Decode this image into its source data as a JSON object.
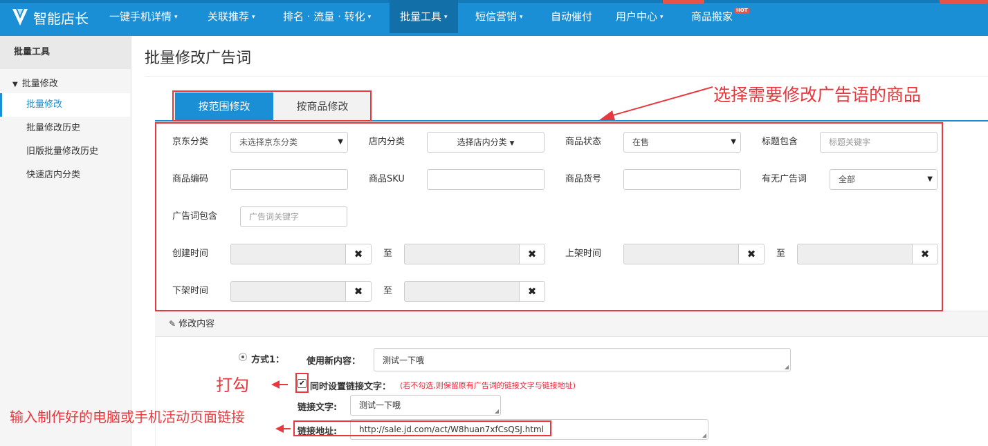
{
  "nav": {
    "brand": "智能店长",
    "items": [
      {
        "label": "一键手机详情",
        "caret": "▾"
      },
      {
        "label": "关联推荐",
        "caret": "▾"
      },
      {
        "label": "排名 · 流量 · 转化",
        "caret": "▾"
      },
      {
        "label": "批量工具",
        "caret": "▾"
      },
      {
        "label": "短信营销",
        "caret": "▾"
      },
      {
        "label": "自动催付",
        "caret": ""
      },
      {
        "label": "用户中心",
        "caret": "▾"
      },
      {
        "label": "商品搬家",
        "caret": ""
      }
    ],
    "hot_badge": "HOT",
    "colors": {
      "bar": "#1a8fd5",
      "active": "#126fa8",
      "accent_red": "#e8534a"
    }
  },
  "sidebar": {
    "header": "批量工具",
    "group": "批量修改",
    "items": [
      "批量修改",
      "批量修改历史",
      "旧版批量修改历史",
      "快速店内分类"
    ]
  },
  "page": {
    "title": "批量修改广告词",
    "tabs": [
      "按范围修改",
      "按商品修改"
    ]
  },
  "filters": {
    "jd_category_label": "京东分类",
    "jd_category_value": "未选择京东分类",
    "shop_category_label": "店内分类",
    "shop_category_value": "选择店内分类",
    "status_label": "商品状态",
    "status_value": "在售",
    "title_label": "标题包含",
    "title_placeholder": "标题关键字",
    "code_label": "商品编码",
    "sku_label": "商品SKU",
    "item_no_label": "商品货号",
    "has_ad_label": "有无广告词",
    "has_ad_value": "全部",
    "ad_contains_label": "广告词包含",
    "ad_contains_placeholder": "广告词关键字",
    "created_label": "创建时间",
    "to": "至",
    "listed_label": "上架时间",
    "delisted_label": "下架时间"
  },
  "modify": {
    "section_title": "修改内容",
    "method_label": "方式1：",
    "new_content_label": "使用新内容：",
    "new_content_value": "测试一下哦",
    "link_checkbox_label": "同时设置链接文字：",
    "link_note": "(若不勾选,则保留原有广告词的链接文字与链接地址)",
    "link_text_label": "链接文字:",
    "link_text_value": "测试一下哦",
    "link_url_label": "链接地址:",
    "link_url_value": "http://sale.jd.com/act/W8huan7xfCsQSJ.html"
  },
  "annotations": {
    "select_goods": "选择需要修改广告语的商品",
    "check_it": "打勾",
    "enter_link": "输入制作好的电脑或手机活动页面链接",
    "color": "#e8383d"
  }
}
